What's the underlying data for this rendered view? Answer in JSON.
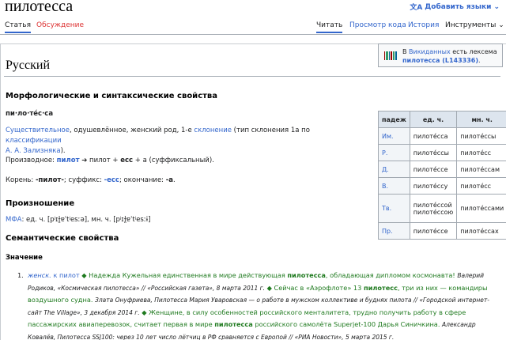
{
  "page": {
    "title": "пилотесса",
    "add_languages": "Добавить языки"
  },
  "tabs": {
    "article": "Статья",
    "talk": "Обсуждение",
    "read": "Читать",
    "view_source": "Просмотр кода",
    "history": "История",
    "tools": "Инструменты"
  },
  "content": {
    "language_heading": "Русский",
    "morph_heading": "Морфологические и синтаксические свойства",
    "syllables": "пи·ло·тéс·са",
    "pos_line": {
      "pos": "Существительное",
      "props": ", одушевлённое, женский род, 1-е ",
      "declension": "склонение",
      "type_pre": " (тип склонения 1a по ",
      "classification": "классификации",
      "author": "А. А. Зализняка",
      "end": ")."
    },
    "derivation": {
      "label": "Производное: ",
      "base": "пилот",
      "arrow": " ➔ пилот + ",
      "suffix": "есс",
      "rest": " + а (суффиксальный)."
    },
    "root_line": {
      "label": "Корень: ",
      "root": "-пилот-",
      "suffix_label": "; суффикс: ",
      "suffix": "-есс",
      "ending_label": "; окончание: ",
      "ending": "-а",
      "end": "."
    },
    "pron_heading": "Произношение",
    "ipa": {
      "label": "МФА",
      "sg": ": ед. ч. [pʲɪɫ̪ɐˈtʲesːə]",
      "pl": ", мн. ч. [pʲɪɫ̪ɐˈtʲesːɨ]"
    },
    "semantic_heading": "Семантические свойства",
    "meaning_heading": "Значение",
    "example": {
      "number": "1.",
      "gram": "женск.",
      "gram_link": "к пилот",
      "line1_a": " ◆ Надежда Кужельная единственная в мире действующая ",
      "word1": "пилотесса",
      "line1_b": ", обладающая дипломом космонавта! ",
      "src1": "Валерий Родиков, «Космическая пилотесса» // «Российская газета», 8 марта 2011 г.",
      "line2_a": " ◆ Сейчас в «Аэрофлоте» 13 ",
      "word2": "пилотесс",
      "line2_b": ", три из них — командиры воздушного судна. ",
      "src2": "Злата Онуфриева, Пилотесса Мария Уваровская — о работе в мужском коллективе и буднях пилота // «Городской интернет-сайт The Village», 3 декабря 2014 г.",
      "line3_a": " ◆ Женщине, в силу особенностей российского менталитета, трудно получить работу в сфере пассажирских авиаперевозок, считает первая в мире ",
      "word3": "пилотесса",
      "line3_b": " российского самолёта Superjet-100 Дарья Синичкина. ",
      "src3": "Александр Ковалёв, Пилотесса SSJ100: через 10 лет число лётчиц в РФ сравняется с Европой // «РИА Новости», 5 марта 2015 г."
    }
  },
  "wikidata": {
    "prefix": "В ",
    "link": "Викиданных",
    "mid": " есть лексема",
    "lexeme": "пилотесса (L143336)",
    "end": "."
  },
  "declension_table": {
    "headers": [
      "падеж",
      "ед. ч.",
      "мн. ч."
    ],
    "rows": [
      {
        "case": "Им.",
        "sg": "пилотécса",
        "pl": "пилотécсы"
      },
      {
        "case": "Р.",
        "sg": "пилотécсы",
        "pl": "пилотécс"
      },
      {
        "case": "Д.",
        "sg": "пилотécсе",
        "pl": "пилотécсам"
      },
      {
        "case": "В.",
        "sg": "пилотécсу",
        "pl": "пилотécс"
      },
      {
        "case": "Тв.",
        "sg": "пилотécсой пилотécсою",
        "pl": "пилотécсами"
      },
      {
        "case": "Пр.",
        "sg": "пилотécсе",
        "pl": "пилотécсах"
      }
    ]
  }
}
